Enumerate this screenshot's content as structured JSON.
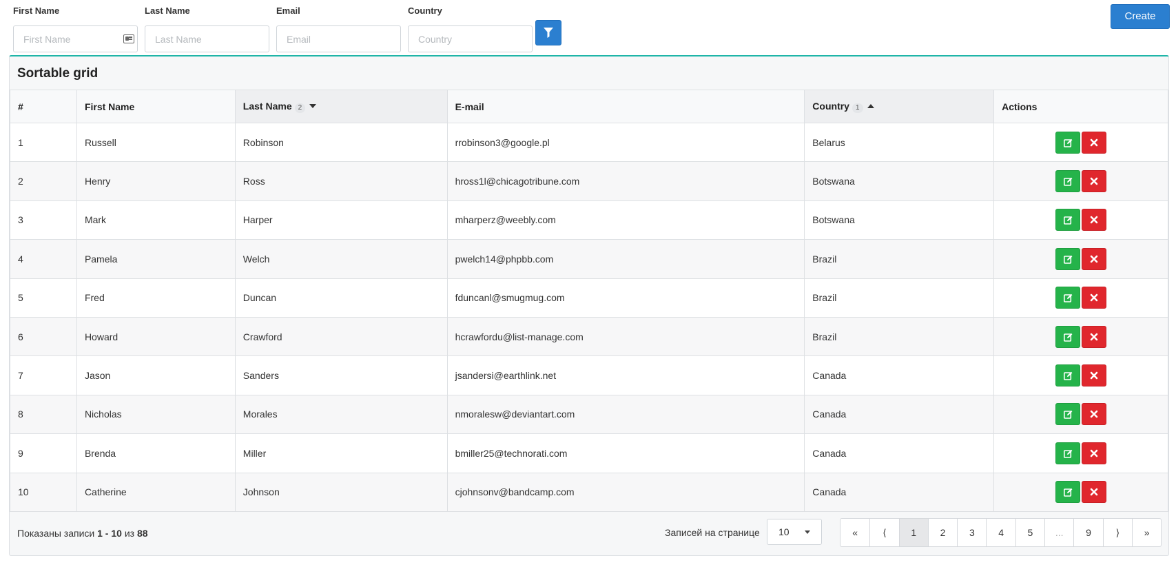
{
  "filters": {
    "first_name": {
      "label": "First Name",
      "placeholder": "First Name"
    },
    "last_name": {
      "label": "Last Name",
      "placeholder": "Last Name"
    },
    "email": {
      "label": "Email",
      "placeholder": "Email"
    },
    "country": {
      "label": "Country",
      "placeholder": "Country"
    }
  },
  "create_label": "Create",
  "grid": {
    "title": "Sortable grid",
    "columns": {
      "num": "#",
      "first_name": "First Name",
      "last_name": "Last Name",
      "last_name_sort_order": "2",
      "email": "E-mail",
      "country": "Country",
      "country_sort_order": "1",
      "actions": "Actions"
    },
    "rows": [
      {
        "num": "1",
        "first": "Russell",
        "last": "Robinson",
        "email": "rrobinson3@google.pl",
        "country": "Belarus"
      },
      {
        "num": "2",
        "first": "Henry",
        "last": "Ross",
        "email": "hross1l@chicagotribune.com",
        "country": "Botswana"
      },
      {
        "num": "3",
        "first": "Mark",
        "last": "Harper",
        "email": "mharperz@weebly.com",
        "country": "Botswana"
      },
      {
        "num": "4",
        "first": "Pamela",
        "last": "Welch",
        "email": "pwelch14@phpbb.com",
        "country": "Brazil"
      },
      {
        "num": "5",
        "first": "Fred",
        "last": "Duncan",
        "email": "fduncanl@smugmug.com",
        "country": "Brazil"
      },
      {
        "num": "6",
        "first": "Howard",
        "last": "Crawford",
        "email": "hcrawfordu@list-manage.com",
        "country": "Brazil"
      },
      {
        "num": "7",
        "first": "Jason",
        "last": "Sanders",
        "email": "jsandersi@earthlink.net",
        "country": "Canada"
      },
      {
        "num": "8",
        "first": "Nicholas",
        "last": "Morales",
        "email": "nmoralesw@deviantart.com",
        "country": "Canada"
      },
      {
        "num": "9",
        "first": "Brenda",
        "last": "Miller",
        "email": "bmiller25@technorati.com",
        "country": "Canada"
      },
      {
        "num": "10",
        "first": "Catherine",
        "last": "Johnson",
        "email": "cjohnsonv@bandcamp.com",
        "country": "Canada"
      }
    ]
  },
  "footer": {
    "info_prefix": "Показаны записи",
    "range": "1 - 10",
    "of": "из",
    "total": "88",
    "per_page_label": "Записей на странице",
    "per_page_value": "10",
    "pages": [
      "«",
      "⟨",
      "1",
      "2",
      "3",
      "4",
      "5",
      "...",
      "9",
      "⟩",
      "»"
    ],
    "active_page": "1"
  },
  "colors": {
    "accent": "#2b7fd0",
    "edit": "#25b34a",
    "delete": "#e0272d",
    "card_top": "#1fb5a8"
  },
  "icons": {
    "filter": "filter-icon",
    "edit": "edit-icon",
    "delete": "close-icon",
    "id_card": "id-card-icon"
  }
}
